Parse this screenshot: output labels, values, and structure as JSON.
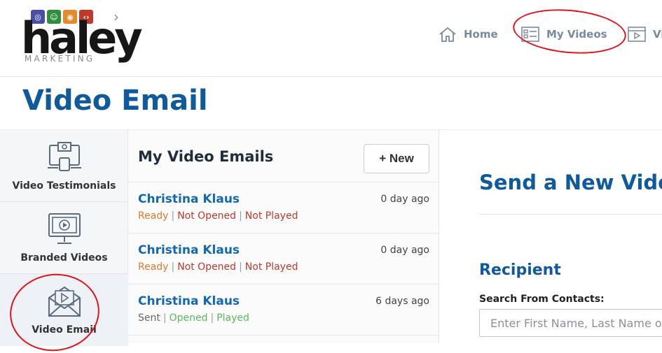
{
  "brand": {
    "logo_word": "haley",
    "logo_sub": "MARKETING",
    "tile_colors": [
      "#4b4fa3",
      "#2f8f3a",
      "#e58a2a",
      "#c0392b"
    ],
    "chevron_color": "#8f8f8f"
  },
  "nav": {
    "home_label": "Home",
    "my_videos_label": "My Videos",
    "videos_label": "Vi"
  },
  "page": {
    "title": "Video Email"
  },
  "sidebar": {
    "items": [
      {
        "label": "Video Testimonials",
        "icon": "video-testimonial-icon"
      },
      {
        "label": "Branded Videos",
        "icon": "monitor-play-icon"
      },
      {
        "label": "Video Email",
        "icon": "envelope-play-icon"
      }
    ]
  },
  "list": {
    "title": "My Video Emails",
    "new_button": "+ New",
    "rows": [
      {
        "name": "Christina Klaus",
        "time": "0 day ago",
        "s1": "Ready",
        "s2": "Not Opened",
        "s3": "Not Played",
        "sep": "|"
      },
      {
        "name": "Christina Klaus",
        "time": "0 day ago",
        "s1": "Ready",
        "s2": "Not Opened",
        "s3": "Not Played",
        "sep": "|"
      },
      {
        "name": "Christina Klaus",
        "time": "6 days ago",
        "s1": "Sent",
        "s2": "Opened",
        "s3": "Played",
        "sep": "|"
      }
    ]
  },
  "compose": {
    "title": "Send a New Video",
    "recipient_heading": "Recipient",
    "search_label": "Search From Contacts:",
    "search_placeholder": "Enter First Name, Last Name or"
  },
  "colors": {
    "accent": "#0f5a9c",
    "link": "#1268b3",
    "annotation": "#e0141c"
  }
}
